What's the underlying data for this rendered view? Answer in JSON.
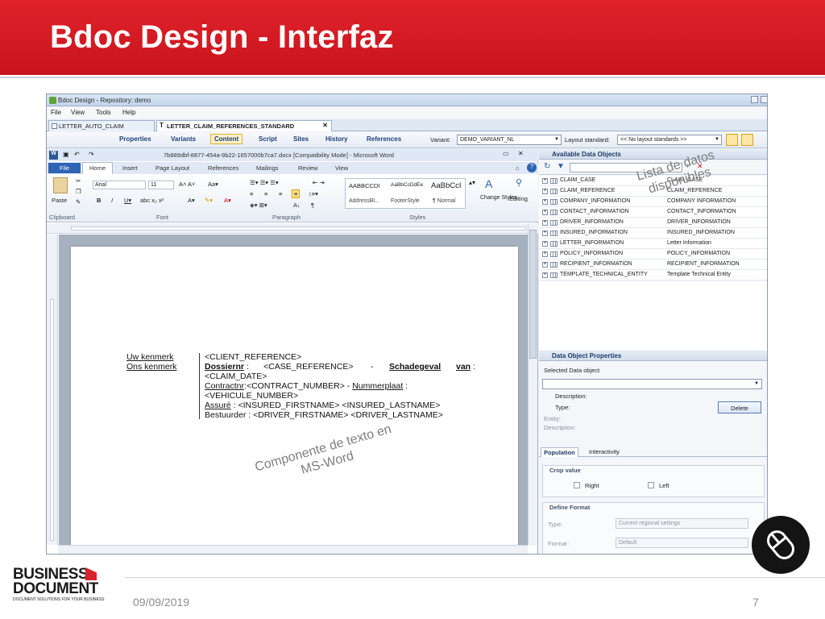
{
  "slide": {
    "title": "Bdoc Design - Interfaz",
    "date": "09/09/2019",
    "page_number": "7",
    "colors": {
      "title_band": "#d41b23",
      "footer_text": "#8c8c8c"
    }
  },
  "logo": {
    "line1": "BUSINESS",
    "line2": "DOCUMENT",
    "tagline": "DOCUMENT SOLUTIONS FOR YOUR BUSINESS"
  },
  "app": {
    "window_title": "Bdoc Design - Repository: demo",
    "menu": [
      "File",
      "View",
      "Tools",
      "Help"
    ],
    "doc_tabs": [
      "LETTER_AUTO_CLAIM",
      "LETTER_CLAIM_REFERENCES_STANDARD"
    ],
    "toolbar": {
      "buttons": [
        "Properties",
        "Variants",
        "Content",
        "Script",
        "Sites",
        "History",
        "References"
      ],
      "selected": "Content",
      "variant_label": "Variant:",
      "variant_value": "DEMO_VARIANT_NL",
      "layout_label": "Layout standard:",
      "layout_value": "<< No layout standards >>"
    }
  },
  "word": {
    "title": "7b889dbf-8877-454a-9b22-1657000b7ca7.docx [Compatibility Mode] - Microsoft Word",
    "tabs": [
      "File",
      "Home",
      "Insert",
      "Page Layout",
      "References",
      "Mailings",
      "Review",
      "View"
    ],
    "groups": [
      "Clipboard",
      "Font",
      "Paragraph",
      "Styles",
      "Editing"
    ],
    "paste_label": "Paste",
    "font_name": "Arial",
    "font_size": "11",
    "styles": [
      {
        "sample": "AABBCCDI",
        "name": "AddressBl..."
      },
      {
        "sample": "AaBbCcDdEe",
        "name": "FooterStyle"
      },
      {
        "sample": "AaBbCcI",
        "name": "¶ Normal"
      }
    ],
    "change_styles": "Change Styles",
    "editing": "Editing",
    "doc": {
      "left_1": "Uw kenmerk",
      "left_2": "Ons kenmerk",
      "line1": "<CLIENT_REFERENCE>",
      "line2_a": "Dossiernr",
      "line2_b": ":",
      "line2_c": "<CASE_REFERENCE>",
      "line2_d": "-",
      "line2_e": "Schadegeval",
      "line2_f": "van",
      "line2_g": ":",
      "line3": "<CLAIM_DATE>",
      "line4_a": "Contractnr",
      "line4_b": ":<CONTRACT_NUMBER> - ",
      "line4_c": "Nummerplaat",
      "line4_d": " :",
      "line5": "<VEHICULE_NUMBER>",
      "line6_a": "Assuré",
      "line6_b": " : <INSURED_FIRSTNAME> <INSURED_LASTNAME>",
      "line7": "Bestuurder : <DRIVER_FIRSTNAME> <DRIVER_LASTNAME>"
    }
  },
  "panel": {
    "available_title": "Available Data Objects",
    "rows": [
      [
        "CLAIM_CASE",
        "CLAIM_CASE"
      ],
      [
        "CLAIM_REFERENCE",
        "CLAIM_REFERENCE"
      ],
      [
        "COMPANY_INFORMATION",
        "COMPANY INFORMATION"
      ],
      [
        "CONTACT_INFORMATION",
        "CONTACT_INFORMATION"
      ],
      [
        "DRIVER_INFORMATION",
        "DRIVER_INFORMATION"
      ],
      [
        "INSURED_INFORMATION",
        "INSURED_INFORMATION"
      ],
      [
        "LETTER_INFORMATION",
        "Letter Information"
      ],
      [
        "POLICY_INFORMATION",
        "POLICY_INFORMATION"
      ],
      [
        "RECIPIENT_INFORMATION",
        "RECIPIENT_INFORMATION"
      ],
      [
        "TEMPLATE_TECHNICAL_ENTITY",
        "Template Technical Entity"
      ]
    ],
    "props_title": "Data Object Properties",
    "selected_label": "Selected Data object",
    "description_label": "Description:",
    "type_label": "Type:",
    "delete_label": "Delete",
    "entity_label": "Entity:",
    "description2_label": "Description:",
    "tabs": [
      "Population",
      "Interactivity"
    ],
    "crop_title": "Crop value",
    "crop_right": "Right",
    "crop_left": "Left",
    "format_title": "Define Format",
    "format_type_label": "Type:",
    "format_type_value": "Current regional settings",
    "format_label": "Format :",
    "format_value": "Default"
  },
  "annotations": {
    "data_list": "Lista de datos disponibles",
    "text_component": "Componente de texto en MS-Word"
  }
}
